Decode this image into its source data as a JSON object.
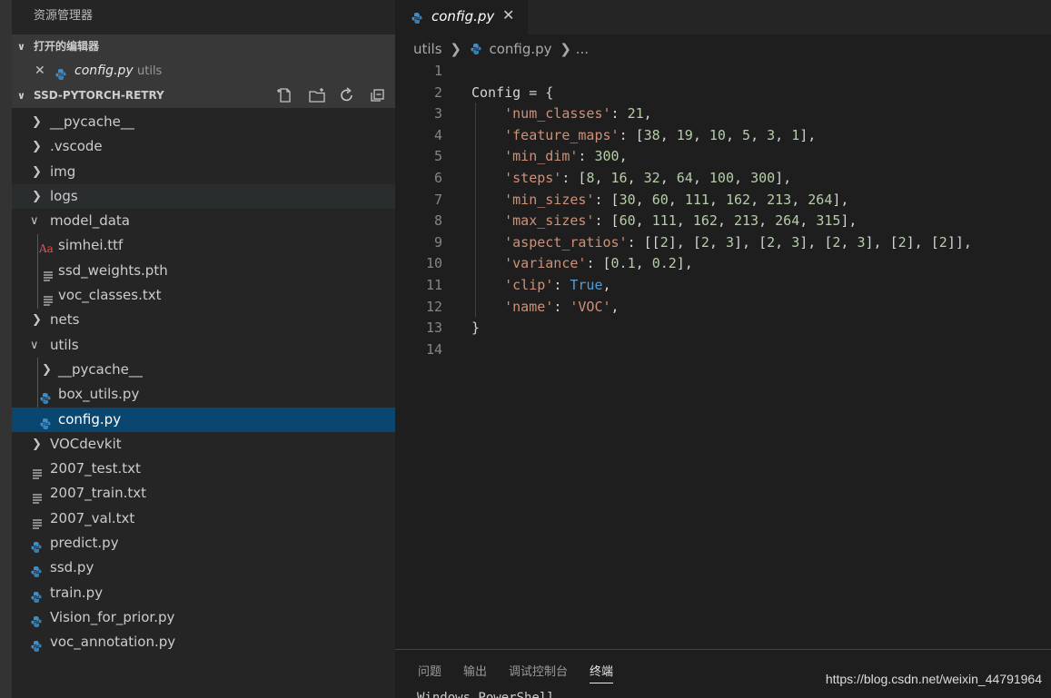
{
  "sidebar": {
    "title": "资源管理器",
    "open_editors": {
      "header": "打开的编辑器",
      "items": [
        {
          "close": "✕",
          "name": "config.py",
          "dir": "utils"
        }
      ]
    },
    "project": {
      "header": "SSD-PYTORCH-RETRY",
      "tree": [
        {
          "label": "__pycache__",
          "type": "folder",
          "state": "collapsed",
          "depth": 0
        },
        {
          "label": ".vscode",
          "type": "folder",
          "state": "collapsed",
          "depth": 0
        },
        {
          "label": "img",
          "type": "folder",
          "state": "collapsed",
          "depth": 0
        },
        {
          "label": "logs",
          "type": "folder",
          "state": "collapsed",
          "depth": 0
        },
        {
          "label": "model_data",
          "type": "folder",
          "state": "expanded",
          "depth": 0
        },
        {
          "label": "simhei.ttf",
          "type": "font",
          "depth": 1
        },
        {
          "label": "ssd_weights.pth",
          "type": "text",
          "depth": 1
        },
        {
          "label": "voc_classes.txt",
          "type": "text",
          "depth": 1
        },
        {
          "label": "nets",
          "type": "folder",
          "state": "collapsed",
          "depth": 0
        },
        {
          "label": "utils",
          "type": "folder",
          "state": "expanded",
          "depth": 0
        },
        {
          "label": "__pycache__",
          "type": "folder",
          "state": "collapsed",
          "depth": 1
        },
        {
          "label": "box_utils.py",
          "type": "python",
          "depth": 1
        },
        {
          "label": "config.py",
          "type": "python",
          "depth": 1
        },
        {
          "label": "VOCdevkit",
          "type": "folder",
          "state": "collapsed",
          "depth": 0
        },
        {
          "label": "2007_test.txt",
          "type": "text",
          "depth": 0
        },
        {
          "label": "2007_train.txt",
          "type": "text",
          "depth": 0
        },
        {
          "label": "2007_val.txt",
          "type": "text",
          "depth": 0
        },
        {
          "label": "predict.py",
          "type": "python",
          "depth": 0
        },
        {
          "label": "ssd.py",
          "type": "python",
          "depth": 0
        },
        {
          "label": "train.py",
          "type": "python",
          "depth": 0
        },
        {
          "label": "Vision_for_prior.py",
          "type": "python",
          "depth": 0
        },
        {
          "label": "voc_annotation.py",
          "type": "python",
          "depth": 0
        }
      ]
    }
  },
  "editor": {
    "tab": {
      "name": "config.py",
      "close": "✕"
    },
    "breadcrumb": {
      "folder": "utils",
      "file": "config.py",
      "more": "..."
    },
    "line_numbers": [
      "1",
      "2",
      "3",
      "4",
      "5",
      "6",
      "7",
      "8",
      "9",
      "10",
      "11",
      "12",
      "13",
      "14"
    ],
    "code": [
      "",
      "Config = {",
      "    'num_classes': 21,",
      "    'feature_maps': [38, 19, 10, 5, 3, 1],",
      "    'min_dim': 300,",
      "    'steps': [8, 16, 32, 64, 100, 300],",
      "    'min_sizes': [30, 60, 111, 162, 213, 264],",
      "    'max_sizes': [60, 111, 162, 213, 264, 315],",
      "    'aspect_ratios': [[2], [2, 3], [2, 3], [2, 3], [2], [2]],",
      "    'variance': [0.1, 0.2],",
      "    'clip': True,",
      "    'name': 'VOC',",
      "}",
      ""
    ]
  },
  "panel": {
    "tabs": [
      "问题",
      "输出",
      "调试控制台",
      "终端"
    ],
    "active_tab": "终端",
    "terminal_line": "Windows PowerShell"
  },
  "watermark": "https://blog.csdn.net/weixin_44791964",
  "colors": {
    "selected": "#094771",
    "string": "#ce9178",
    "number": "#b5cea8",
    "keyword": "#569cd6"
  }
}
